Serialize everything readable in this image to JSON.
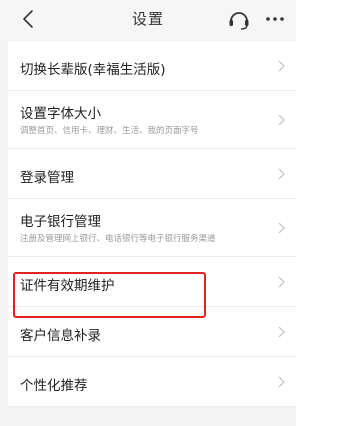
{
  "header": {
    "title": "设置",
    "back_icon": "chevron-left-icon",
    "support_icon": "headset-icon",
    "more_icon": "more-dots-icon"
  },
  "settings": {
    "items": [
      {
        "label": "切换长辈版(幸福生活版)"
      },
      {
        "label": "设置字体大小",
        "sub": "调整首页、信用卡、理财、生活、我的页面字号"
      },
      {
        "label": "登录管理"
      },
      {
        "label": "电子银行管理",
        "sub": "注册及管理网上银行、电话银行等电子银行服务渠道"
      },
      {
        "label": "证件有效期维护"
      },
      {
        "label": "客户信息补录"
      },
      {
        "label": "个性化推荐"
      }
    ]
  },
  "colors": {
    "highlight": "#e32222",
    "background": "#f3f3f3",
    "chevron": "#c8c8c8"
  }
}
